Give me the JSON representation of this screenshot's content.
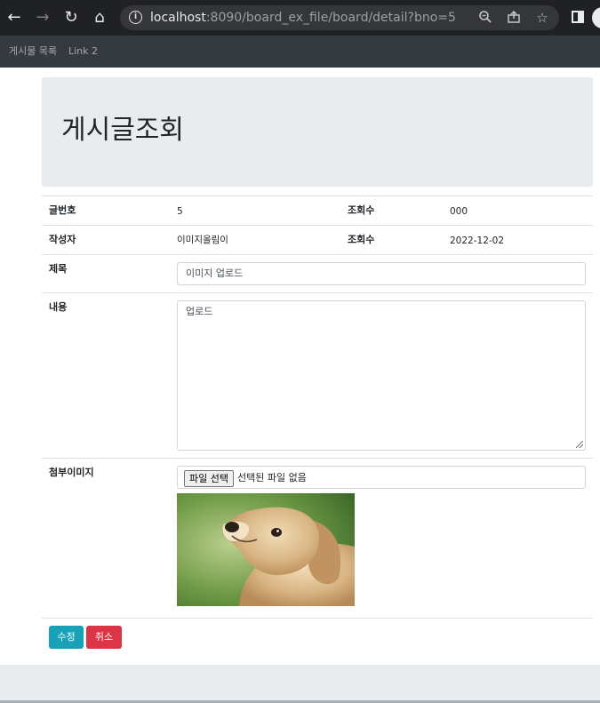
{
  "browser": {
    "url_host": "localhost",
    "url_rest": ":8090/board_ex_file/board/detail?bno=5",
    "back_icon": "arrow-left-icon",
    "forward_icon": "arrow-right-icon",
    "reload_icon": "reload-icon",
    "home_icon": "home-icon"
  },
  "navbar": {
    "links": [
      "게시물 목록",
      "Link 2"
    ]
  },
  "jumbotron": {
    "title": "게시글조회"
  },
  "table": {
    "row1": {
      "label_no": "글번호",
      "value_no": "5",
      "label_views": "조회수",
      "value_views": "000"
    },
    "row2": {
      "label_writer": "작성자",
      "value_writer": "이미지올림이",
      "label_date": "조회수",
      "value_date": "2022-12-02"
    },
    "title_label": "제목",
    "title_value": "이미지 업로드",
    "content_label": "내용",
    "content_value": "업로드",
    "attach_label": "첨부이미지",
    "file_button": "파일 선택",
    "file_status": "선택된 파일 없음"
  },
  "buttons": {
    "edit": "수정",
    "cancel": "취소"
  },
  "colors": {
    "navbar_bg": "#343a40",
    "jumbotron_bg": "#e9ecef",
    "btn_info": "#17a2b8",
    "btn_danger": "#dc3545"
  }
}
